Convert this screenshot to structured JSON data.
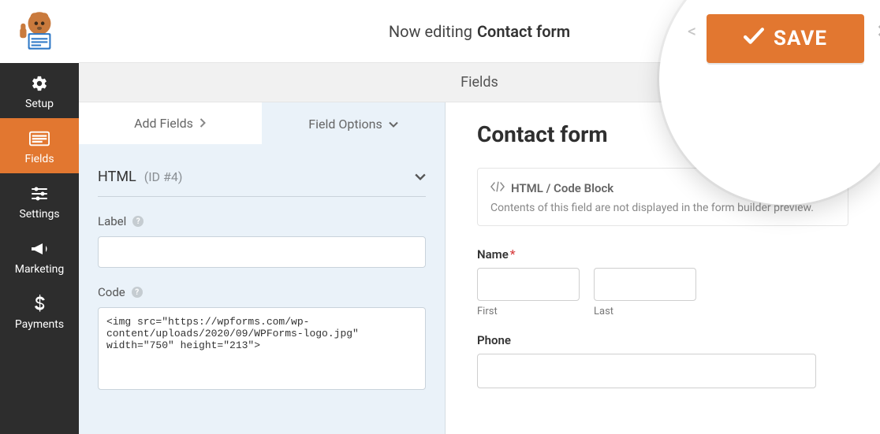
{
  "sidebar": {
    "items": [
      {
        "label": "Setup",
        "icon": "gear-icon"
      },
      {
        "label": "Fields",
        "icon": "fields-icon"
      },
      {
        "label": "Settings",
        "icon": "sliders-icon"
      },
      {
        "label": "Marketing",
        "icon": "megaphone-icon"
      },
      {
        "label": "Payments",
        "icon": "dollar-icon"
      }
    ]
  },
  "topbar": {
    "prefix": "Now editing",
    "title": "Contact form"
  },
  "subbar": {
    "title": "Fields"
  },
  "tabs": {
    "add": "Add Fields",
    "options": "Field Options"
  },
  "options_panel": {
    "heading": "HTML",
    "sub": "(ID #4)",
    "label_label": "Label",
    "label_value": "",
    "code_label": "Code",
    "code_value": "<img src=\"https://wpforms.com/wp-content/uploads/2020/09/WPForms-logo.jpg\" width=\"750\" height=\"213\">"
  },
  "preview": {
    "form_title": "Contact form",
    "code_block": {
      "title": "HTML / Code Block",
      "desc": "Contents of this field are not displayed in the form builder preview."
    },
    "name_label": "Name",
    "first": "First",
    "last": "Last",
    "phone_label": "Phone"
  },
  "zoom": {
    "save_label": "SAVE"
  }
}
